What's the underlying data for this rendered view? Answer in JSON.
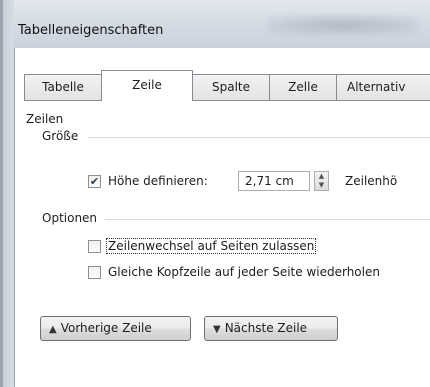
{
  "window": {
    "title": "Tabelleneigenschaften"
  },
  "tabs": [
    {
      "label": "Tabelle",
      "active": false
    },
    {
      "label": "Zeile",
      "active": true
    },
    {
      "label": "Spalte",
      "active": false
    },
    {
      "label": "Zelle",
      "active": false
    },
    {
      "label": "Alternativ",
      "active": false
    }
  ],
  "zeilen": {
    "heading": "Zeilen",
    "groesse": {
      "label": "Größe",
      "hoehe_checkbox": {
        "label": "Höhe definieren:",
        "checked": true
      },
      "hoehe_value": "2,71 cm",
      "zeilenhoehe_label": "Zeilenhö"
    },
    "optionen": {
      "label": "Optionen",
      "zeilenwechsel": {
        "label": "Zeilenwechsel auf Seiten zulassen",
        "checked": false
      },
      "kopfzeile": {
        "label": "Gleiche Kopfzeile auf jeder Seite wiederholen",
        "checked": false
      }
    }
  },
  "buttons": {
    "prev": {
      "label": "Vorherige Zeile",
      "icon": "triangle-up-icon"
    },
    "next": {
      "label": "Nächste Zeile",
      "icon": "triangle-down-icon"
    }
  },
  "colors": {
    "chrome": "#d3dae3",
    "panel_border": "#898c95"
  }
}
